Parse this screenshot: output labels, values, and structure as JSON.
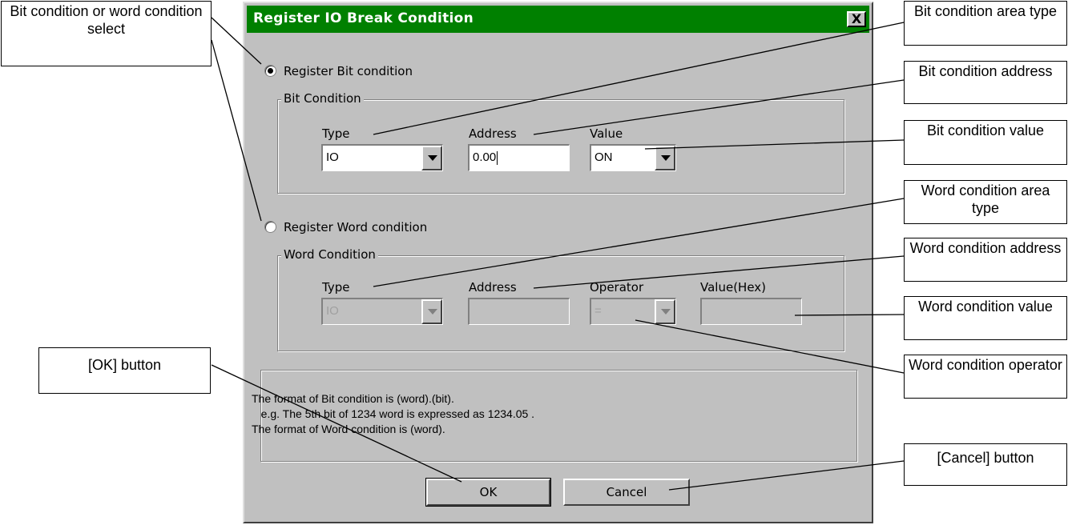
{
  "dialog": {
    "title": "Register IO Break Condition",
    "close_glyph": "X",
    "bit_radio_label": "Register Bit condition",
    "bit_group_title": "Bit Condition",
    "bit_type_label": "Type",
    "bit_address_label": "Address",
    "bit_value_label": "Value",
    "bit_type_value": "IO",
    "bit_address_value": "0.00",
    "bit_value_value": "ON",
    "word_radio_label": "Register Word condition",
    "word_group_title": "Word Condition",
    "word_type_label": "Type",
    "word_address_label": "Address",
    "word_operator_label": "Operator",
    "word_value_label": "Value(Hex)",
    "word_type_value": "IO",
    "word_address_value": "",
    "word_operator_value": "=",
    "word_value_value": "",
    "info_lines": [
      "The format of Bit condition is (word).(bit).",
      "   e.g. The 5th bit of 1234 word is expressed as 1234.05 .",
      "The format of Word condition is (word)."
    ],
    "ok_label": "OK",
    "cancel_label": "Cancel",
    "selected_mode": "bit"
  },
  "callouts": {
    "select": "Bit condition or word condition select",
    "bit_area_type": "Bit condition area type",
    "bit_address": "Bit condition address",
    "bit_value": "Bit condition value",
    "word_area_type": "Word condition area type",
    "word_address": "Word condition address",
    "word_value": "Word condition value",
    "word_operator": "Word condition operator",
    "ok_button": "[OK] button",
    "cancel_button": "[Cancel] button"
  },
  "colors": {
    "titlebar": "#008000",
    "dialog_face": "#c0c0c0"
  }
}
